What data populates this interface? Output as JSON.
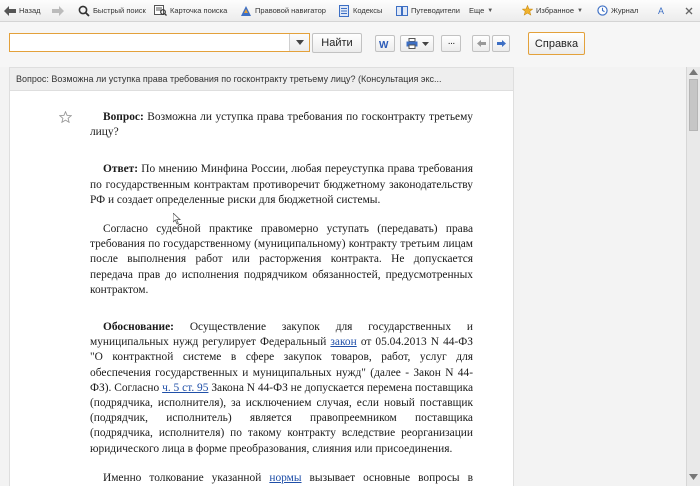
{
  "toolbar": {
    "back_label": "Назад",
    "quick_search_label": "Быстрый поиск",
    "search_card_label": "Карточка поиска",
    "legal_navigator_label": "Правовой навигатор",
    "codes_label": "Кодексы",
    "guides_label": "Путеводители",
    "more_label": "Еще",
    "favorites_label": "Избранное",
    "journal_label": "Журнал",
    "font_label": "А"
  },
  "search": {
    "value": "",
    "placeholder": "",
    "find_label": "Найти",
    "help_label": "Справка",
    "more_dots": "···"
  },
  "document": {
    "header_title": "Вопрос: Возможна ли уступка права требования по госконтракту третьему лицу? (Консультация экс...",
    "question_label": "Вопрос:",
    "question_text": " Возможна ли уступка права требования по госконтракту третьему лицу?",
    "answer_label": "Ответ:",
    "answer_text": " По мнению Минфина России, любая переуступка права требования по государственным контрактам противоречит бюджетному законодательству РФ и создает определенные риски для бюджетной системы.",
    "practice_text": "Согласно судебной практике правомерно уступать (передавать) права требования по государственному (муниципальному) контракту третьим лицам после выполнения работ или расторжения контракта. Не допускается передача прав до исполнения подрядчиком обязанностей, предусмотренных контрактом.",
    "basis_label": "Обоснование:",
    "basis_text_1": " Осуществление закупок для государственных и муниципальных нужд регулирует Федеральный ",
    "basis_link_law": "закон",
    "basis_text_2": " от 05.04.2013 N 44-ФЗ \"О контрактной системе в сфере закупок товаров, работ, услуг для обеспечения государственных и муниципальных нужд\" (далее - Закон N 44-ФЗ). Согласно ",
    "basis_link_article": "ч. 5 ст. 95",
    "basis_text_3": " Закона N 44-ФЗ не допускается перемена поставщика (подрядчика, исполнителя), за исключением случая, если новый поставщик (подрядчик, исполнитель) является правопреемником поставщика (подрядчика, исполнителя) по такому контракту вследствие реорганизации юридического лица в форме преобразования, слияния или присоединения.",
    "last_text_1": "Именно толкование указанной ",
    "last_link": "нормы",
    "last_text_2": " вызывает основные вопросы в правоприменительной практике."
  }
}
